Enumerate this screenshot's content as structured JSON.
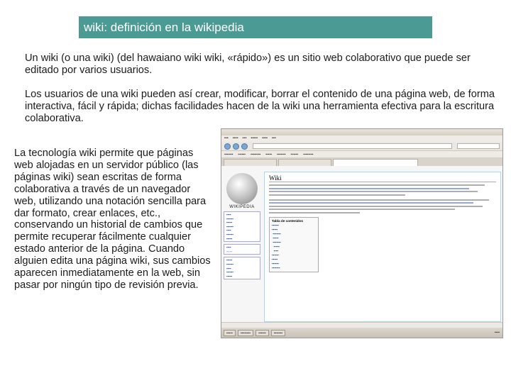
{
  "title": "wiki: definición en la wikipedia",
  "paragraphs": [
    "Un wiki (o una wiki) (del hawaiano wiki wiki, «rápido») es un sitio web colaborativo que puede ser editado por varios usuarios.",
    "Los usuarios de una wiki pueden así crear, modificar, borrar el contenido de una página web, de forma interactiva, fácil y rápida; dichas facilidades hacen de la wiki una herramienta efectiva para la escritura colaborativa.",
    "La tecnología wiki permite que páginas web alojadas en un servidor público (las páginas wiki) sean escritas de forma colaborativa a través de un navegador web, utilizando una notación sencilla para dar formato, crear enlaces, etc., conservando un historial de cambios que permite recuperar fácilmente cualquier estado anterior de la página. Cuando alguien edita una página wiki, sus cambios aparecen inmediatamente en la web, sin pasar por ningún tipo de revisión previa."
  ],
  "screenshot": {
    "logo_text": "WIKIPEDIA",
    "article_title": "Wiki",
    "toc_title": "Tabla de contenidos"
  }
}
